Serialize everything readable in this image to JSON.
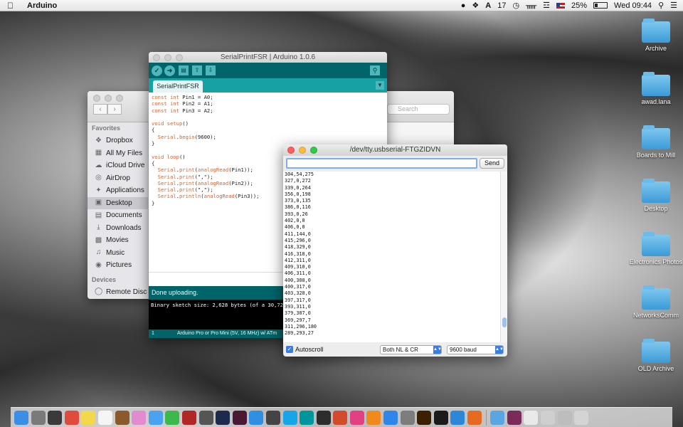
{
  "menubar": {
    "app_name": "Arduino",
    "notifications_count": "17",
    "battery": "25%",
    "clock": "Wed 09:44"
  },
  "desktop_icons": [
    {
      "label": "Archive"
    },
    {
      "label": "awad.lana"
    },
    {
      "label": "Boards to Mill"
    },
    {
      "label": "Desktop"
    },
    {
      "label": "Electronics Photos"
    },
    {
      "label": "NetworksComm"
    },
    {
      "label": "OLD Archive"
    }
  ],
  "finder": {
    "search_placeholder": "Search",
    "favorites_header": "Favorites",
    "favorites": [
      {
        "label": "Dropbox",
        "icon": "dropbox-icon"
      },
      {
        "label": "All My Files",
        "icon": "files-icon"
      },
      {
        "label": "iCloud Drive",
        "icon": "cloud-icon"
      },
      {
        "label": "AirDrop",
        "icon": "airdrop-icon"
      },
      {
        "label": "Applications",
        "icon": "apps-icon"
      },
      {
        "label": "Desktop",
        "icon": "desktop-icon"
      },
      {
        "label": "Documents",
        "icon": "document-icon"
      },
      {
        "label": "Downloads",
        "icon": "download-icon"
      },
      {
        "label": "Movies",
        "icon": "movie-icon"
      },
      {
        "label": "Music",
        "icon": "music-icon"
      },
      {
        "label": "Pictures",
        "icon": "camera-icon"
      }
    ],
    "devices_header": "Devices",
    "devices": [
      {
        "label": "Remote Disc",
        "icon": "disc-icon"
      }
    ]
  },
  "ide": {
    "title": "SerialPrintFSR | Arduino 1.0.6",
    "tab": "SerialPrintFSR",
    "code_lines": [
      "const int Pin1 = A0;",
      "const int Pin2 = A1;",
      "const int Pin3 = A2;",
      "",
      "void setup()",
      "{",
      "  Serial.begin(9600);",
      "}",
      "",
      "void loop()",
      "{",
      "  Serial.print(analogRead(Pin1));",
      "  Serial.print(\",\");",
      "  Serial.print(analogRead(Pin2));",
      "  Serial.print(\",\");",
      "  Serial.println(analogRead(Pin3));",
      "}"
    ],
    "status": "Done uploading.",
    "console": "Binary sketch size: 2,628 bytes (of a 30,720 by",
    "footer_line": "1",
    "footer_board": "Arduino Pro or Pro Mini (5V, 16 MHz) w/ ATm"
  },
  "serial": {
    "title": "/dev/tty.usbserial-FTGZIDVN",
    "input_value": "",
    "send_label": "Send",
    "output_lines": [
      "304,54,275",
      "327,0,272",
      "339,0,264",
      "356,0,198",
      "373,0,135",
      "386,0,116",
      "393,0,26",
      "402,0,0",
      "406,0,0",
      "411,144,0",
      "415,296,0",
      "418,329,0",
      "416,318,0",
      "412,311,0",
      "409,310,0",
      "406,311,0",
      "400,308,0",
      "400,317,0",
      "403,328,0",
      "397,317,0",
      "393,311,0",
      "379,307,0",
      "369,297,7",
      "311,296,180",
      "289,293,27"
    ],
    "autoscroll_label": "Autoscroll",
    "line_ending": "Both NL & CR",
    "baud": "9600 baud"
  },
  "dock": [
    {
      "icon": "finder-icon",
      "color": "#3b8ee6"
    },
    {
      "icon": "launchpad-icon",
      "color": "#7a7a7a"
    },
    {
      "icon": "mission-control-icon",
      "color": "#3a3a3a"
    },
    {
      "icon": "chrome-icon",
      "color": "#e04b3c"
    },
    {
      "icon": "stickies-icon",
      "color": "#f2d84a"
    },
    {
      "icon": "calendar-icon",
      "color": "#f5f5f5"
    },
    {
      "icon": "notebook-icon",
      "color": "#8b5a2b"
    },
    {
      "icon": "photos-icon",
      "color": "#e28bd0"
    },
    {
      "icon": "messages-icon",
      "color": "#4aa3f0"
    },
    {
      "icon": "facetime-icon",
      "color": "#3cb94a"
    },
    {
      "icon": "photo-booth-icon",
      "color": "#b32626"
    },
    {
      "icon": "script-icon",
      "color": "#555555"
    },
    {
      "icon": "photoshop-icon",
      "color": "#1d2a4d"
    },
    {
      "icon": "indesign-icon",
      "color": "#4a1835"
    },
    {
      "icon": "cura-icon",
      "color": "#2f8fe0"
    },
    {
      "icon": "sublime-icon",
      "color": "#444444"
    },
    {
      "icon": "skype-icon",
      "color": "#16a6e8"
    },
    {
      "icon": "arduino-icon",
      "color": "#00979c"
    },
    {
      "icon": "makerbot-icon",
      "color": "#2d2d2d"
    },
    {
      "icon": "rocket-icon",
      "color": "#d24b2a"
    },
    {
      "icon": "itunes-icon",
      "color": "#e33f83"
    },
    {
      "icon": "ibooks-icon",
      "color": "#f08a1f"
    },
    {
      "icon": "app-store-icon",
      "color": "#2f86e8"
    },
    {
      "icon": "preferences-icon",
      "color": "#7d7d7d"
    },
    {
      "icon": "illustrator-icon",
      "color": "#3b2100"
    },
    {
      "icon": "processing-icon",
      "color": "#1b1b1b"
    },
    {
      "icon": "wunderlist-icon",
      "color": "#2b88d8"
    },
    {
      "icon": "firefox-icon",
      "color": "#e66a1f"
    },
    {
      "icon": "applications-folder-icon",
      "color": "#5aa6e2"
    },
    {
      "icon": "indesign-doc-icon",
      "color": "#7b2a5a"
    },
    {
      "icon": "document-stack-icon",
      "color": "#e9e9e9"
    },
    {
      "icon": "screenshot-icon",
      "color": "#cfcfcf"
    },
    {
      "icon": "presentation-icon",
      "color": "#bdbdbd"
    },
    {
      "icon": "trash-icon",
      "color": "#d4d4d4"
    }
  ]
}
